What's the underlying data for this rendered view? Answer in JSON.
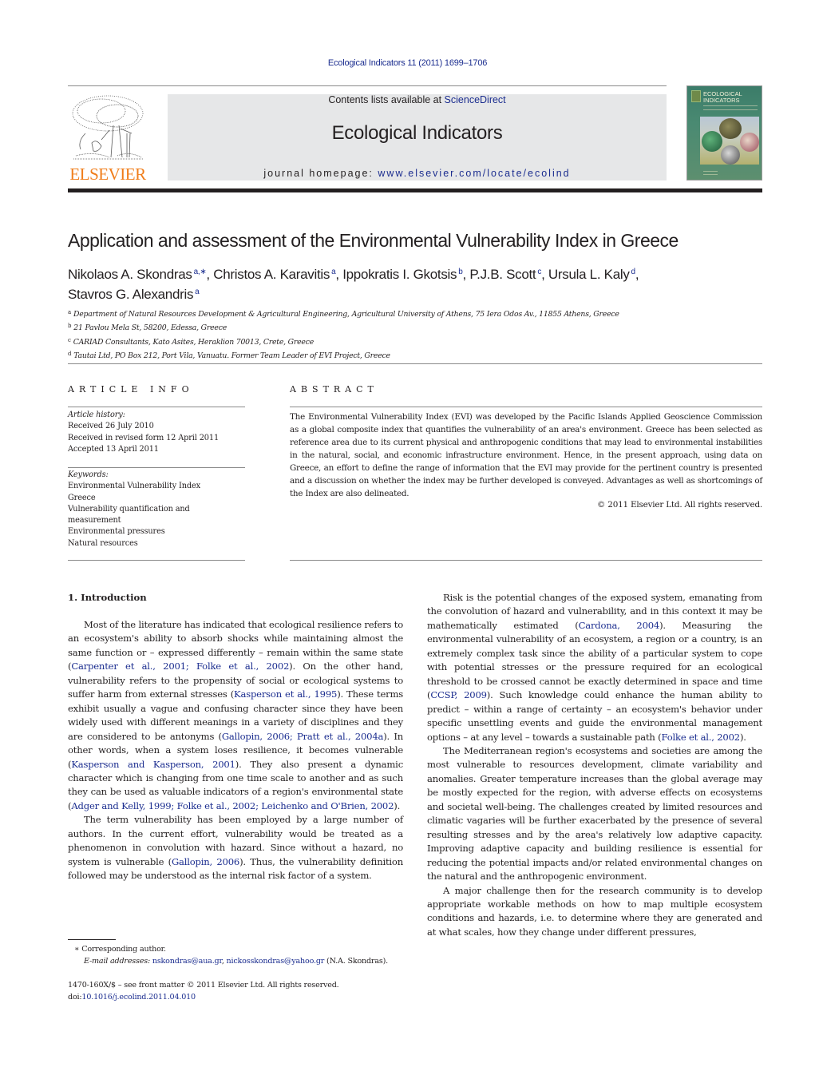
{
  "header": {
    "journal_reference": "Ecological Indicators 11 (2011) 1699–1706",
    "contents_prefix": "Contents lists available at ",
    "contents_link": "ScienceDirect",
    "journal_title": "Ecological Indicators",
    "homepage_prefix": "journal homepage: ",
    "homepage_link": "www.elsevier.com/locate/ecolind",
    "publisher_wordmark": "ELSEVIER",
    "cover_title_line1": "ECOLOGICAL",
    "cover_title_line2": "INDICATORS",
    "colors": {
      "publisher_orange": "#f07d1a",
      "link_blue": "#1b2d8f",
      "masthead_gray": "#e6e7e8"
    }
  },
  "article": {
    "title": "Application and assessment of the Environmental Vulnerability Index in Greece",
    "authors": [
      {
        "name": "Nikolaos A. Skondras",
        "sup": "a,∗",
        "sep": ", "
      },
      {
        "name": "Christos A. Karavitis",
        "sup": "a",
        "sep": ", "
      },
      {
        "name": "Ippokratis I. Gkotsis",
        "sup": "b",
        "sep": ", "
      },
      {
        "name": "P.J.B. Scott",
        "sup": "c",
        "sep": ", "
      },
      {
        "name": "Ursula L. Kaly",
        "sup": "d",
        "sep": ","
      },
      {
        "name": "Stavros G. Alexandris",
        "sup": "a",
        "sep": ""
      }
    ],
    "affiliations": [
      {
        "key": "a",
        "text": "Department of Natural Resources Development & Agricultural Engineering, Agricultural University of Athens, 75 Iera Odos Av., 11855 Athens, Greece"
      },
      {
        "key": "b",
        "text": "21 Pavlou Mela St, 58200, Edessa, Greece"
      },
      {
        "key": "c",
        "text": "CARIAD Consultants, Kato Asites, Heraklion 70013, Crete, Greece"
      },
      {
        "key": "d",
        "text": "Tautai Ltd, PO Box 212, Port Vila, Vanuatu. Former Team Leader of EVI Project, Greece"
      }
    ]
  },
  "article_info": {
    "heading": "ARTICLE INFO",
    "history_label": "Article history:",
    "history": [
      "Received 26 July 2010",
      "Received in revised form 12 April 2011",
      "Accepted 13 April 2011"
    ],
    "keywords_label": "Keywords:",
    "keywords": [
      "Environmental Vulnerability Index",
      "Greece",
      "Vulnerability quantification and measurement",
      "Environmental pressures",
      "Natural resources"
    ]
  },
  "abstract": {
    "heading": "ABSTRACT",
    "text": "The Environmental Vulnerability Index (EVI) was developed by the Pacific Islands Applied Geoscience Commission as a global composite index that quantifies the vulnerability of an area's environment. Greece has been selected as reference area due to its current physical and anthropogenic conditions that may lead to environmental instabilities in the natural, social, and economic infrastructure environment. Hence, in the present approach, using data on Greece, an effort to define the range of information that the EVI may provide for the pertinent country is presented and a discussion on whether the index may be further developed is conveyed. Advantages as well as shortcomings of the Index are also delineated.",
    "copyright": "© 2011 Elsevier Ltd. All rights reserved."
  },
  "body": {
    "section_heading": "1.  Introduction",
    "left_paragraphs": [
      [
        {
          "t": "Most of the literature has indicated that ecological resilience refers to an ecosystem's ability to absorb shocks while maintaining almost the same function or – expressed differently – remain within the same state ("
        },
        {
          "t": "Carpenter et al., 2001; Folke et al., 2002",
          "cite": true
        },
        {
          "t": "). On the other hand, vulnerability refers to the propensity of social or ecological systems to suffer harm from external stresses ("
        },
        {
          "t": "Kasperson et al., 1995",
          "cite": true
        },
        {
          "t": "). These terms exhibit usually a vague and confusing character since they have been widely used with different meanings in a variety of disciplines and they are considered to be antonyms ("
        },
        {
          "t": "Gallopin, 2006; Pratt et al., 2004a",
          "cite": true
        },
        {
          "t": "). In other words, when a system loses resilience, it becomes vulnerable ("
        },
        {
          "t": "Kasperson and Kasperson, 2001",
          "cite": true
        },
        {
          "t": "). They also present a dynamic character which is changing from one time scale to another and as such they can be used as valuable indicators of a region's environmental state ("
        },
        {
          "t": "Adger and Kelly, 1999; Folke et al., 2002; Leichenko and O'Brien, 2002",
          "cite": true
        },
        {
          "t": ")."
        }
      ],
      [
        {
          "t": "The term vulnerability has been employed by a large number of authors. In the current effort, vulnerability would be treated as a phenomenon in convolution with hazard. Since without a hazard, no system is vulnerable ("
        },
        {
          "t": "Gallopin, 2006",
          "cite": true
        },
        {
          "t": "). Thus, the vulnerability definition followed may be understood as the internal risk factor of a system."
        }
      ]
    ],
    "right_paragraphs": [
      [
        {
          "t": "Risk is the potential changes of the exposed system, emanating from the convolution of hazard and vulnerability, and in this context it may be mathematically estimated ("
        },
        {
          "t": "Cardona, 2004",
          "cite": true
        },
        {
          "t": "). Measuring the environmental vulnerability of an ecosystem, a region or a country, is an extremely complex task since the ability of a particular system to cope with potential stresses or the pressure required for an ecological threshold to be crossed cannot be exactly determined in space and time ("
        },
        {
          "t": "CCSP, 2009",
          "cite": true
        },
        {
          "t": "). Such knowledge could enhance the human ability to predict – within a range of certainty – an ecosystem's behavior under specific unsettling events and guide the environmental management options – at any level – towards a sustainable path ("
        },
        {
          "t": "Folke et al., 2002",
          "cite": true
        },
        {
          "t": ")."
        }
      ],
      [
        {
          "t": "The Mediterranean region's ecosystems and societies are among the most vulnerable to resources development, climate variability and anomalies. Greater temperature increases than the global average may be mostly expected for the region, with adverse effects on ecosystems and societal well-being. The challenges created by limited resources and climatic vagaries will be further exacerbated by the presence of several resulting stresses and by the area's relatively low adaptive capacity. Improving adaptive capacity and building resilience is essential for reducing the potential impacts and/or related environmental changes on the natural and the anthropogenic environment."
        }
      ],
      [
        {
          "t": "A major challenge then for the research community is to develop appropriate workable methods on how to map multiple ecosystem conditions and hazards, i.e. to determine where they are generated and at what scales, how they change under different pressures,"
        }
      ]
    ]
  },
  "footnotes": {
    "corresponding_mark": "∗",
    "corresponding_text": "Corresponding author.",
    "email_label": "E-mail addresses:",
    "email_1": "nskondras@aua.gr",
    "email_sep": ", ",
    "email_2": "nickosskondras@yahoo.gr",
    "email_owner": " (N.A. Skondras).",
    "front_matter": "1470-160X/$ – see front matter © 2011 Elsevier Ltd. All rights reserved.",
    "doi_prefix": "doi:",
    "doi": "10.1016/j.ecolind.2011.04.010"
  }
}
